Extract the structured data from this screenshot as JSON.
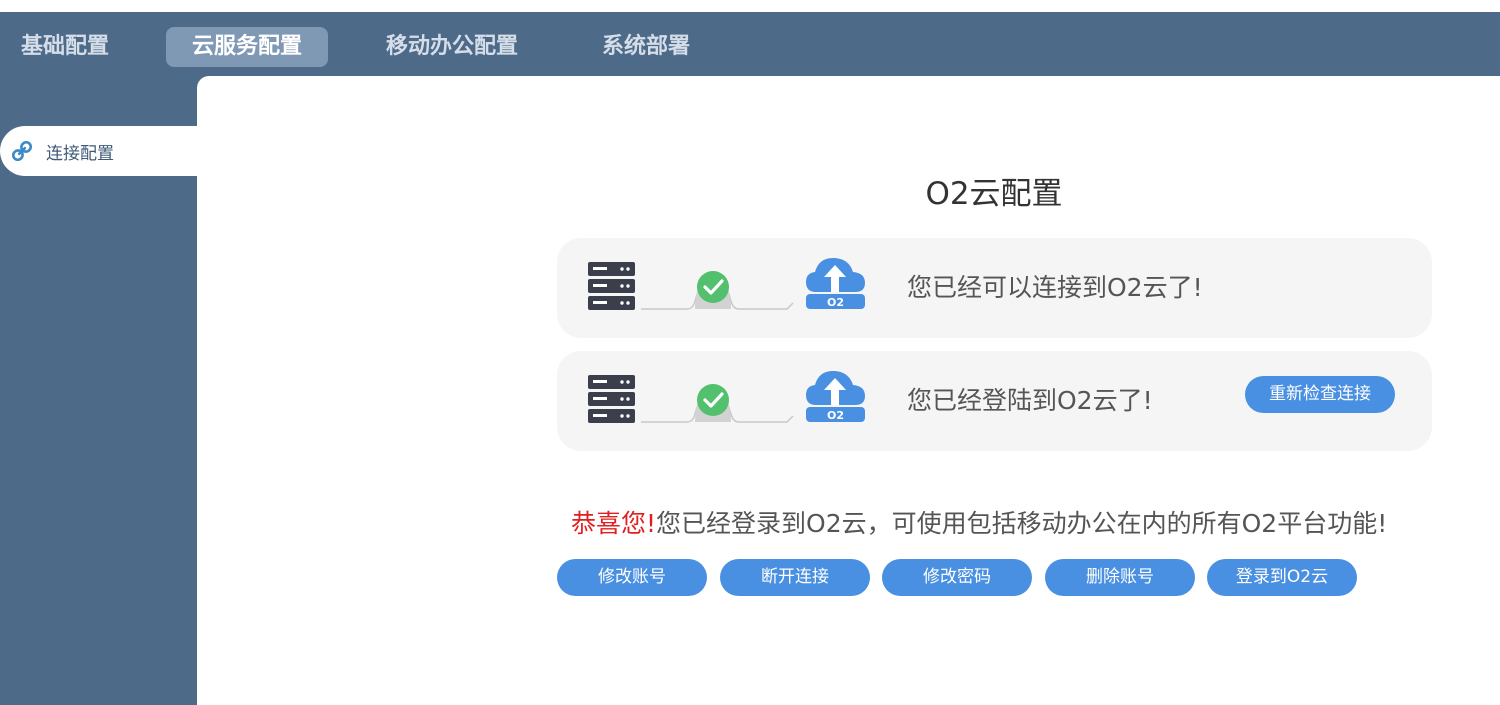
{
  "nav": {
    "tabs": [
      {
        "label": "基础配置"
      },
      {
        "label": "云服务配置"
      },
      {
        "label": "移动办公配置"
      },
      {
        "label": "系统部署"
      }
    ],
    "active_tab": "云服务配置"
  },
  "sidebar": {
    "items": [
      {
        "label": "连接配置",
        "icon": "link-icon"
      }
    ]
  },
  "main": {
    "title": "O2云配置",
    "cards": [
      {
        "text": "您已经可以连接到O2云了!"
      },
      {
        "text": "您已经登陆到O2云了!",
        "button": "重新检查连接"
      }
    ],
    "cloud_badge": "O2",
    "congrats": "恭喜您!",
    "success_message": "您已经登录到O2云，可使用包括移动办公在内的所有O2平台功能!",
    "actions": [
      {
        "label": "修改账号"
      },
      {
        "label": "断开连接"
      },
      {
        "label": "修改密码"
      },
      {
        "label": "删除账号"
      },
      {
        "label": "登录到O2云"
      }
    ]
  },
  "colors": {
    "header_bg": "#4d6a89",
    "active_tab_bg": "#7f99b5",
    "button_blue": "#4a90e2",
    "check_green": "#52c06d",
    "congrats_red": "#e02020"
  }
}
